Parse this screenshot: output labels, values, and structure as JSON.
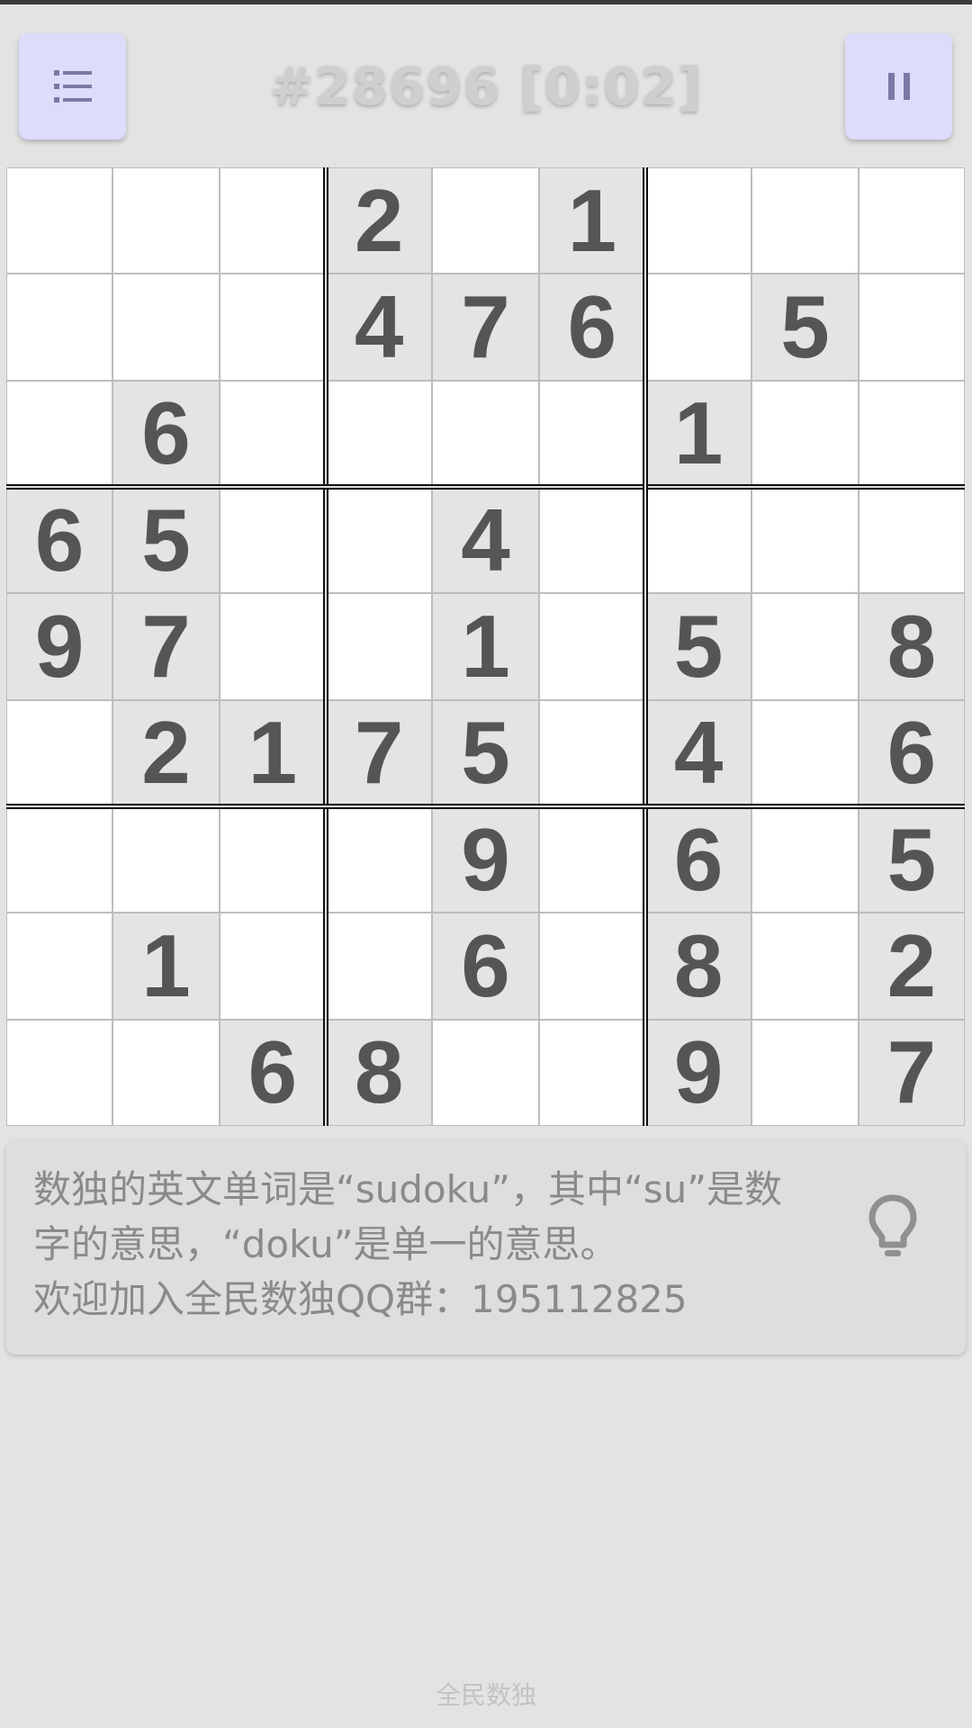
{
  "header": {
    "title": "#28696 [0:02]",
    "menu_icon": "menu-list-icon",
    "pause_icon": "pause-icon"
  },
  "board": {
    "grid": [
      [
        0,
        0,
        0,
        2,
        0,
        1,
        0,
        0,
        0
      ],
      [
        0,
        0,
        0,
        4,
        7,
        6,
        0,
        5,
        0
      ],
      [
        0,
        6,
        0,
        0,
        0,
        0,
        1,
        0,
        0
      ],
      [
        6,
        5,
        0,
        0,
        4,
        0,
        0,
        0,
        0
      ],
      [
        9,
        7,
        0,
        0,
        1,
        0,
        5,
        0,
        8
      ],
      [
        0,
        2,
        1,
        7,
        5,
        0,
        4,
        0,
        6
      ],
      [
        0,
        0,
        0,
        0,
        9,
        0,
        6,
        0,
        5
      ],
      [
        0,
        1,
        0,
        0,
        6,
        0,
        8,
        0,
        2
      ],
      [
        0,
        0,
        6,
        8,
        0,
        0,
        9,
        0,
        7
      ]
    ]
  },
  "tip": {
    "text": "数独的英文单词是“sudoku”，其中“su”是数\n字的意思，“doku”是单一的意思。\n欢迎加入全民数独QQ群：195112825",
    "icon": "lightbulb-icon"
  },
  "footer": {
    "app_name": "全民数独"
  },
  "colors": {
    "background": "#e3e3e3",
    "button_bg": "#dcdcfb",
    "given_cell": "#e4e4e4",
    "empty_cell": "#ffffff",
    "digit": "#555555",
    "box_border": "#111111"
  }
}
